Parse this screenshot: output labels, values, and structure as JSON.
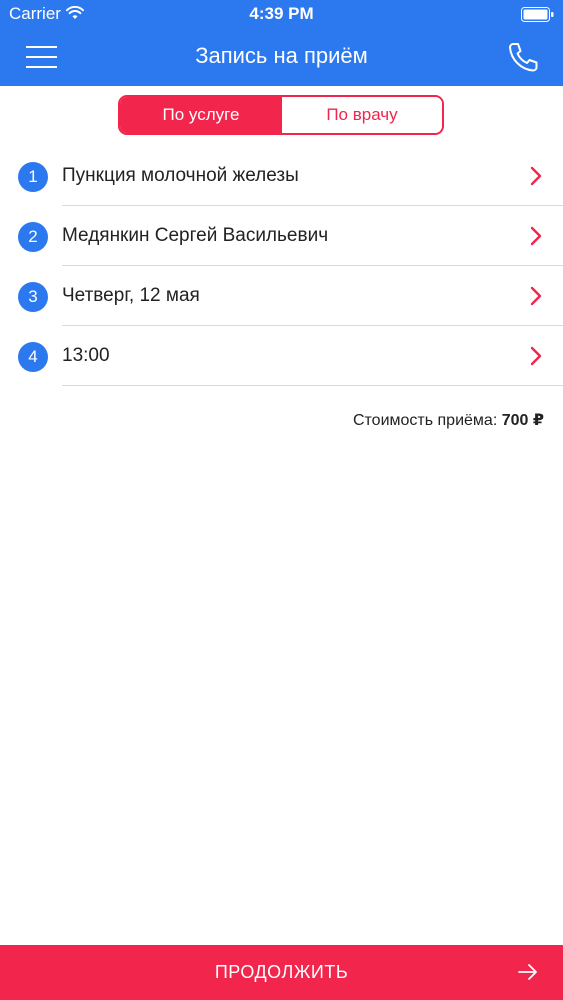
{
  "status_bar": {
    "carrier": "Carrier",
    "time": "4:39 PM",
    "wifi_icon": "wifi-icon",
    "battery_icon": "battery-icon"
  },
  "nav": {
    "title": "Запись на приём",
    "menu_icon": "hamburger-menu-icon",
    "phone_icon": "phone-icon"
  },
  "segmented": {
    "options": [
      "По услуге",
      "По врачу"
    ],
    "selected": "По услуге"
  },
  "steps": [
    {
      "number": "1",
      "label": "Пункция молочной железы"
    },
    {
      "number": "2",
      "label": "Медянкин Сергей Васильевич"
    },
    {
      "number": "3",
      "label": "Четверг, 12 мая"
    },
    {
      "number": "4",
      "label": "13:00"
    }
  ],
  "price": {
    "label": "Стоимость приёма:",
    "value": "700 ₽"
  },
  "continue_button": {
    "label": "ПРОДОЛЖИТЬ",
    "icon": "arrow-right-icon"
  },
  "colors": {
    "primary_blue": "#2b78ef",
    "accent_red": "#f2254d",
    "divider": "#d9d9d9"
  }
}
